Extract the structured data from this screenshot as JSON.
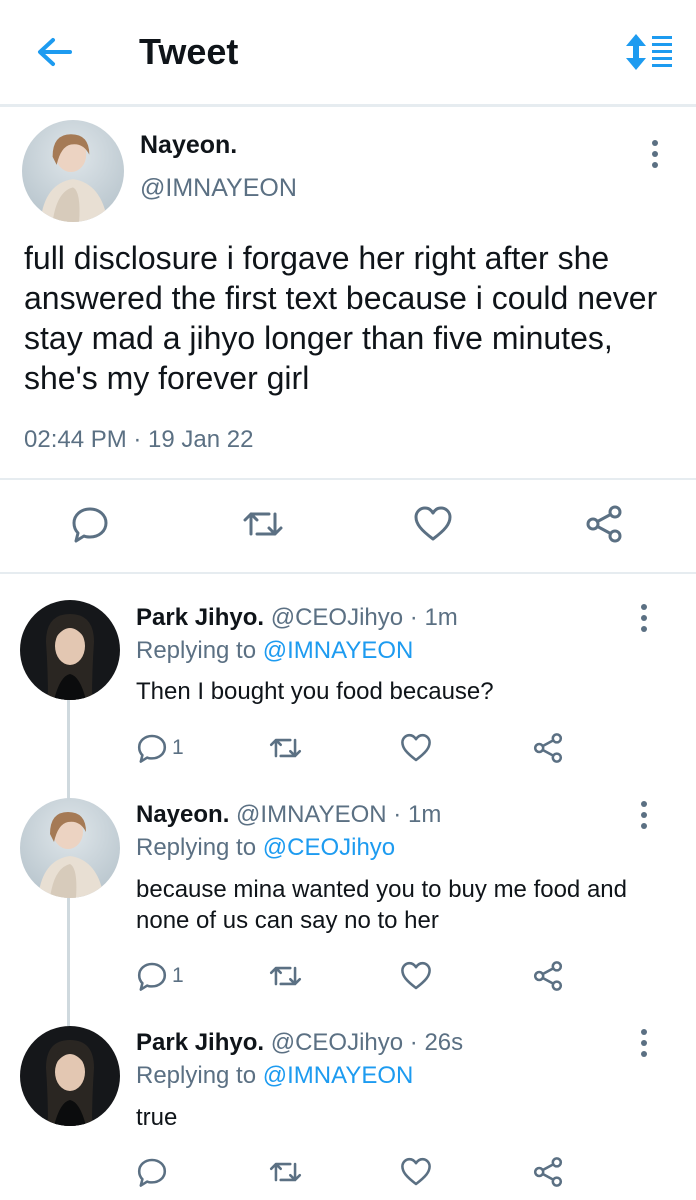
{
  "header": {
    "title": "Tweet",
    "back_icon": "arrow-left-icon",
    "sort_icon": "sort-icon",
    "accent": "#1d9bf0"
  },
  "main_tweet": {
    "name": "Nayeon.",
    "handle": "@IMNAYEON",
    "text": "full disclosure i forgave her right after she answered the first text because i could never stay mad a jihyo longer than five minutes, she's my forever girl",
    "timestamp": "02:44 PM · 19 Jan 22",
    "actions": [
      "reply-icon",
      "retweet-icon",
      "like-icon",
      "share-icon"
    ]
  },
  "replies": [
    {
      "name": "Park Jihyo.",
      "meta": " @CEOJihyo · 1m",
      "replying_prefix": "Replying to ",
      "replying_to": "@IMNAYEON",
      "text": "Then I bought you food because?",
      "reply_count": "1"
    },
    {
      "name": "Nayeon.",
      "meta": " @IMNAYEON · 1m",
      "replying_prefix": "Replying to ",
      "replying_to": "@CEOJihyo",
      "text": "because mina wanted you to buy me food and none of us can say no to her",
      "reply_count": "1"
    },
    {
      "name": "Park Jihyo.",
      "meta": " @CEOJihyo · 26s",
      "replying_prefix": "Replying to ",
      "replying_to": "@IMNAYEON",
      "text": "true",
      "reply_count": ""
    }
  ]
}
